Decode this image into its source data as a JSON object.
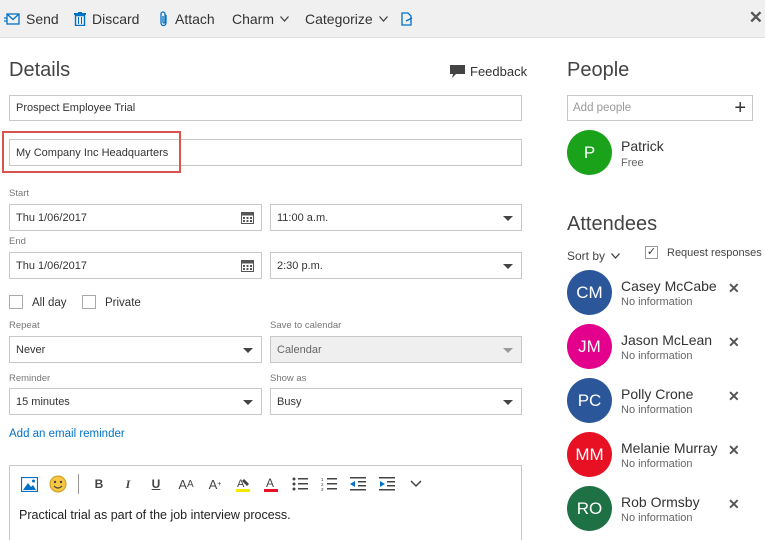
{
  "toolbar": {
    "send": "Send",
    "discard": "Discard",
    "attach": "Attach",
    "charm": "Charm",
    "categorize": "Categorize",
    "close_icon": "close-icon"
  },
  "details": {
    "heading": "Details",
    "feedback": "Feedback",
    "title_value": "Prospect Employee Trial",
    "location_value": "My Company Inc Headquarters",
    "start_label": "Start",
    "start_date": "Thu 1/06/2017",
    "start_time": "11:00 a.m.",
    "end_label": "End",
    "end_date": "Thu 1/06/2017",
    "end_time": "2:30 p.m.",
    "all_day": "All day",
    "private": "Private",
    "repeat_label": "Repeat",
    "repeat_value": "Never",
    "save_label": "Save to calendar",
    "save_value": "Calendar",
    "reminder_label": "Reminder",
    "reminder_value": "15 minutes",
    "show_as_label": "Show as",
    "show_as_value": "Busy",
    "email_reminder_link": "Add an email reminder",
    "body_text": "Practical trial as part of the job interview process."
  },
  "people": {
    "heading": "People",
    "add_placeholder": "Add people",
    "organizer": {
      "initials": "P",
      "name": "Patrick",
      "status": "Free",
      "color": "#1aa31a"
    }
  },
  "attendees": {
    "heading": "Attendees",
    "sort_by": "Sort by",
    "request_responses": "Request responses",
    "request_checked": "✓",
    "list": [
      {
        "initials": "CM",
        "name": "Casey McCabe",
        "status": "No information",
        "color": "#2b579a"
      },
      {
        "initials": "JM",
        "name": "Jason McLean",
        "status": "No information",
        "color": "#e3008c"
      },
      {
        "initials": "PC",
        "name": "Polly Crone",
        "status": "No information",
        "color": "#2b579a"
      },
      {
        "initials": "MM",
        "name": "Melanie Murray",
        "status": "No information",
        "color": "#e81123"
      },
      {
        "initials": "RO",
        "name": "Rob Ormsby",
        "status": "No information",
        "color": "#1e7145"
      }
    ]
  },
  "colors": {
    "accent": "#0072c6",
    "highlight": "#d9534f"
  }
}
